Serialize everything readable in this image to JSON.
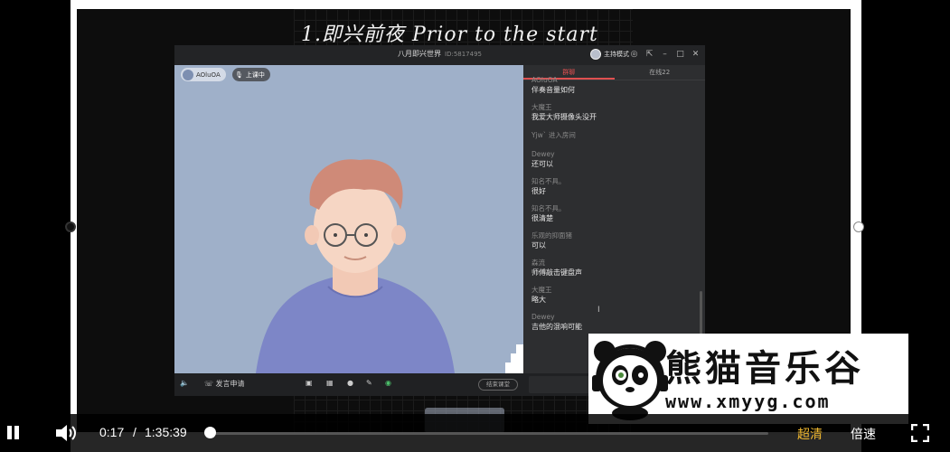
{
  "board": {
    "heading": "1.即兴前夜 Prior to the start"
  },
  "app": {
    "title": "八月即兴世界",
    "room_id": "ID:5817495",
    "host_mode": "主持模式",
    "user_chip": "AOluOA",
    "class_status": "上课中",
    "chat": {
      "tabs": [
        "群聊",
        "在线22"
      ],
      "messages": [
        {
          "name": "AOluOA",
          "text": "伴奏音量如何"
        },
        {
          "name": "大魔王",
          "text": "我爱大师摄像头没开"
        },
        {
          "system": "Yjw` 进入房间"
        },
        {
          "name": "Dewey",
          "text": "还可以"
        },
        {
          "name": "知名不具。",
          "text": "很好"
        },
        {
          "name": "知名不具。",
          "text": "很清楚"
        },
        {
          "name": "乐观的抑面猪",
          "text": "可以"
        },
        {
          "name": "森流",
          "text": "师傅敲击键盘声"
        },
        {
          "name": "大魔王",
          "text": "略大"
        },
        {
          "name": "Dewey",
          "text": "吉他的混响可能"
        }
      ]
    },
    "bottom": {
      "apply_label": "发言申请",
      "end_class_label": "结束课堂"
    }
  },
  "player": {
    "current_time": "0:17",
    "separator": "/",
    "duration": "1:35:39",
    "progress_fraction": 0.0029,
    "quality_label": "超清",
    "speed_label": "倍速",
    "accent_color": "#f0b830"
  },
  "watermark": {
    "title": "熊猫音乐谷",
    "url": "www.xmyyg.com"
  }
}
